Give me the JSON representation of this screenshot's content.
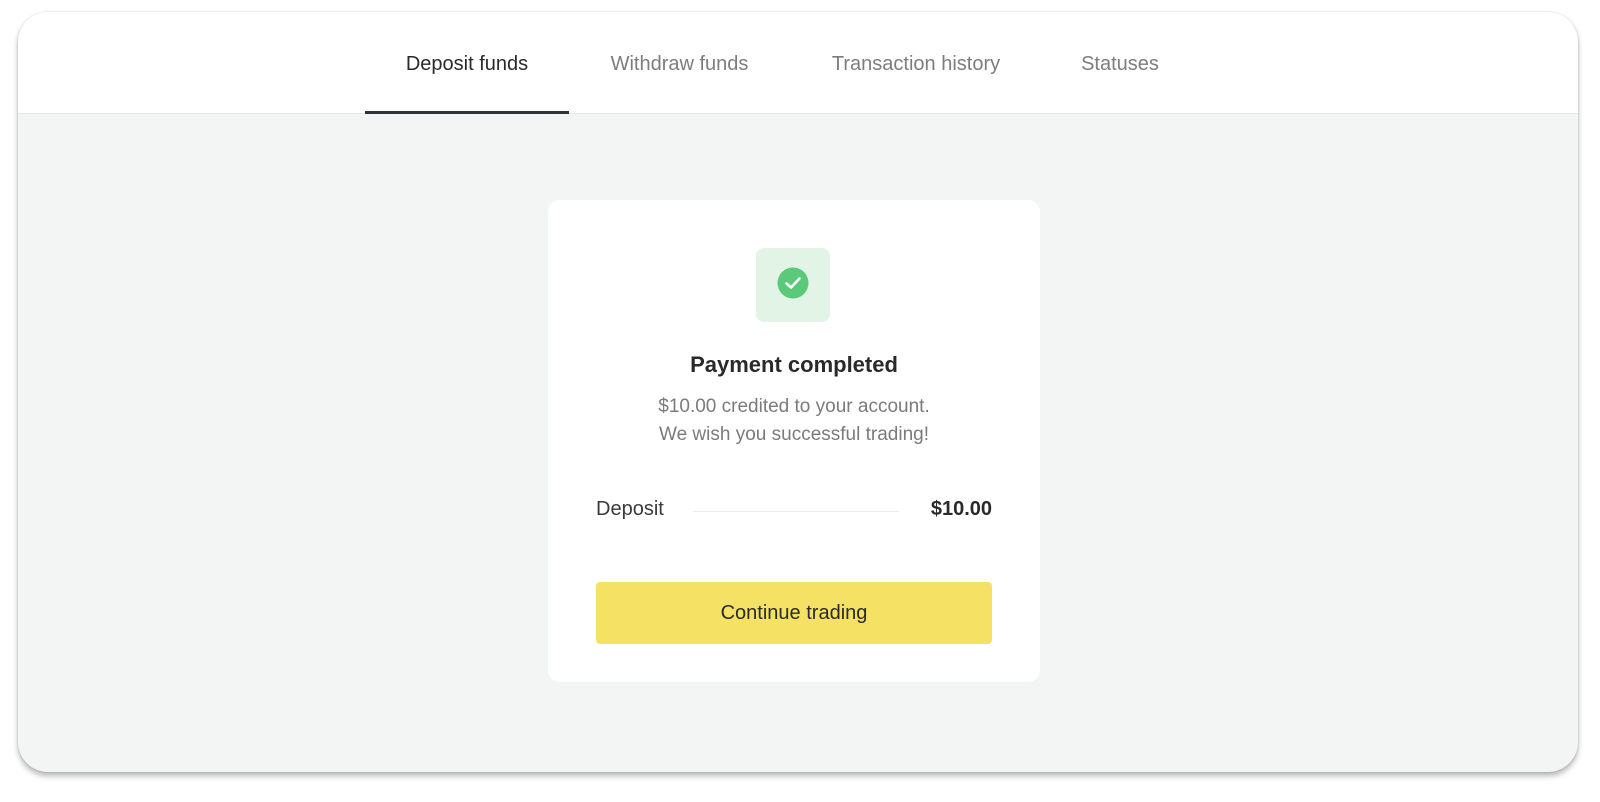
{
  "tabs": [
    {
      "label": "Deposit funds",
      "active": true
    },
    {
      "label": "Withdraw funds",
      "active": false
    },
    {
      "label": "Transaction history",
      "active": false
    },
    {
      "label": "Statuses",
      "active": false
    }
  ],
  "result": {
    "icon": "check-circle-icon",
    "title": "Payment completed",
    "message_line1": "$10.00 credited to your account.",
    "message_line2": "We wish you successful trading!",
    "deposit_label": "Deposit",
    "deposit_value": "$10.00",
    "continue_label": "Continue trading"
  },
  "colors": {
    "accent_button": "#f5e264",
    "success": "#5bc97a",
    "success_bg": "#e2f4e6",
    "background": "#f3f4f4"
  }
}
